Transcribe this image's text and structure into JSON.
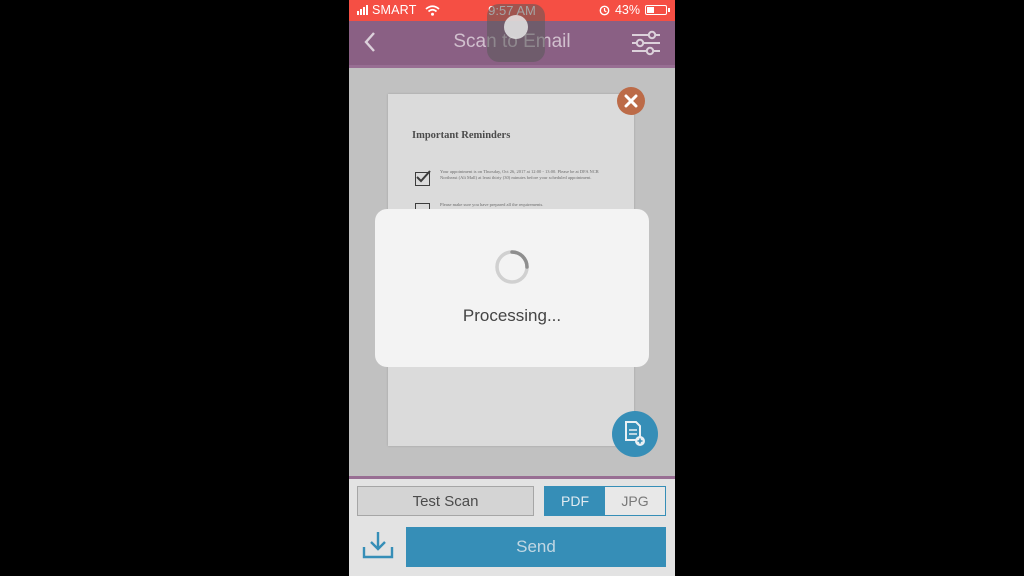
{
  "status_bar": {
    "carrier": "SMART",
    "time": "9:57 AM",
    "battery": "43%",
    "battery_level": 0.43
  },
  "header": {
    "title": "Scan to Email"
  },
  "document": {
    "title": "Important Reminders",
    "paragraph1": "Your appointment is on Thursday, Oct 26, 2017 at 12:00 - 13:00. Please be at DFA NCR Northeast (Ali Mall) at least thirty (30) minutes before your scheduled appointment.",
    "paragraph2": "Please make sure you have prepared all the requirements."
  },
  "dialog": {
    "text": "Processing..."
  },
  "bottom": {
    "filename": "Test Scan",
    "format_pdf": "PDF",
    "format_jpg": "JPG",
    "selected_format": "PDF",
    "send_label": "Send"
  },
  "colors": {
    "status_bar": "#f4372b",
    "header": "#7a4a73",
    "accent": "#1b7fae",
    "close": "#b3572f"
  },
  "icons": [
    "back-icon",
    "filter-icon",
    "close-icon",
    "add-page-icon",
    "save-icon",
    "spinner-icon",
    "wifi-icon",
    "alarm-icon",
    "battery-icon",
    "signal-icon"
  ]
}
